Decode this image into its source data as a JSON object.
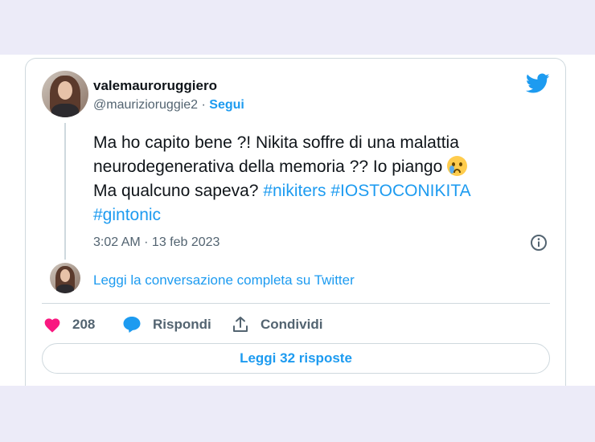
{
  "tweet": {
    "display_name": "valemauroruggiero",
    "handle": "@maurizioruggie2",
    "separator": " · ",
    "follow_label": "Segui",
    "text_part1": "Ma ho capito bene ?! Nikita soffre di una malattia neurodegenerativa della memoria ?? Io piango ",
    "text_part2": "Ma qualcuno sapeva? ",
    "hashtags": [
      "#nikiters",
      "#IOSTOCONIKITA",
      "#gintonic"
    ],
    "emoji": "crying-face",
    "timestamp": "3:02 AM · 13 feb 2023"
  },
  "conversation": {
    "link_label": "Leggi la conversazione completa su Twitter"
  },
  "actions": {
    "like_count": "208",
    "reply_label": "Rispondi",
    "share_label": "Condividi"
  },
  "footer": {
    "read_replies_label": "Leggi 32 risposte"
  },
  "colors": {
    "accent": "#1d9bf0",
    "like": "#f91880",
    "muted": "#536471",
    "text": "#0f1419",
    "page_bg": "#ecebf8"
  },
  "icons": [
    "twitter-bird-icon",
    "info-icon",
    "heart-icon",
    "reply-bubble-icon",
    "share-icon"
  ]
}
